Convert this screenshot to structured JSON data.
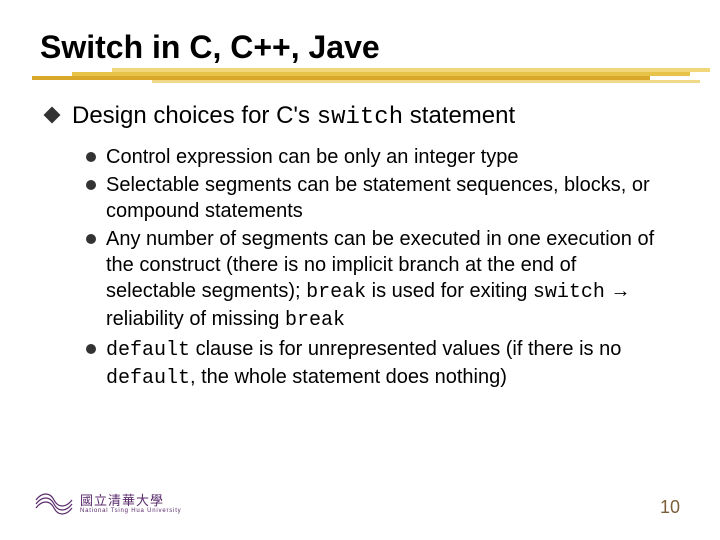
{
  "title": "Switch in C, C++, Jave",
  "top_item": {
    "pre": "Design choices for C's ",
    "code": "switch",
    "post": " statement"
  },
  "sub_items": [
    {
      "segments": [
        {
          "t": "Control expression can be only an integer type",
          "c": false
        }
      ]
    },
    {
      "segments": [
        {
          "t": "Selectable segments can be statement sequences, blocks, or compound statements",
          "c": false
        }
      ]
    },
    {
      "segments": [
        {
          "t": "Any number of segments can be executed in one execution of the construct (there is no implicit branch at the end of selectable segments); ",
          "c": false
        },
        {
          "t": "break",
          "c": true
        },
        {
          "t": " is used for exiting ",
          "c": false
        },
        {
          "t": "switch",
          "c": true
        },
        {
          "t": " ",
          "c": false
        },
        {
          "t": "→",
          "c": false,
          "arrow": true
        },
        {
          "t": " reliability of missing ",
          "c": false
        },
        {
          "t": "break",
          "c": true
        }
      ]
    },
    {
      "segments": [
        {
          "t": "default",
          "c": true
        },
        {
          "t": " clause is for unrepresented values (if there is no ",
          "c": false
        },
        {
          "t": "default",
          "c": true
        },
        {
          "t": ", the whole statement does nothing)",
          "c": false
        }
      ]
    }
  ],
  "logo": {
    "cn": "國立清華大學",
    "en": "National Tsing Hua University"
  },
  "page_number": "10"
}
